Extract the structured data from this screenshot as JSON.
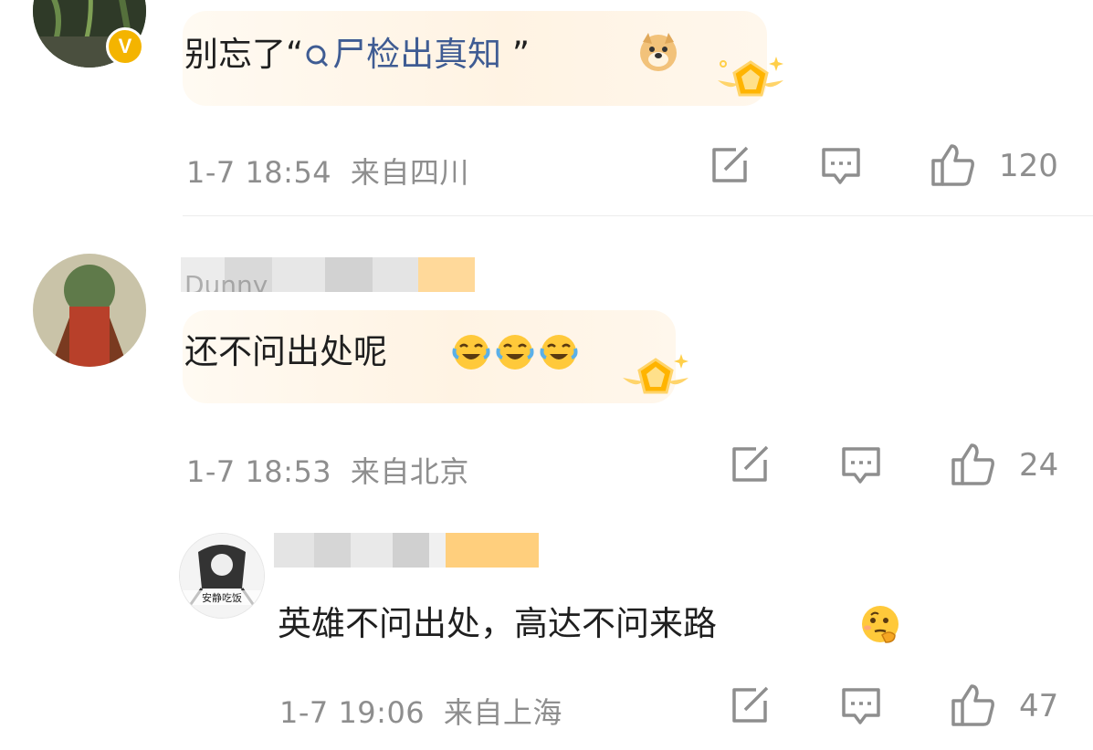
{
  "comments": [
    {
      "text_prefix": "别忘了“",
      "link_text": "尸检出真知",
      "text_suffix": " ”",
      "time": "1-7 18:54",
      "location": "来自四川",
      "like_count": "120",
      "emoji": "doge-face",
      "verified_badge": "V"
    },
    {
      "username_partial": "Dunny",
      "text": "还不问出处呢",
      "time": "1-7 18:53",
      "location": "来自北京",
      "like_count": "24",
      "emoji": "crying-laughing-face x3"
    }
  ],
  "reply": {
    "avatar_caption": "安静吃饭",
    "text": "英雄不问出处，高达不问来路",
    "time": "1-7 19:06",
    "location": "来自上海",
    "like_count": "47",
    "emoji": "thinking-face"
  },
  "icons": [
    "share-icon",
    "comment-icon",
    "like-icon",
    "search-icon",
    "fan-badge-icon"
  ],
  "colors": {
    "link": "#3f5c93",
    "meta": "#8e8e8e",
    "bubble": "#fff4e6",
    "badge": "#f4b400"
  }
}
